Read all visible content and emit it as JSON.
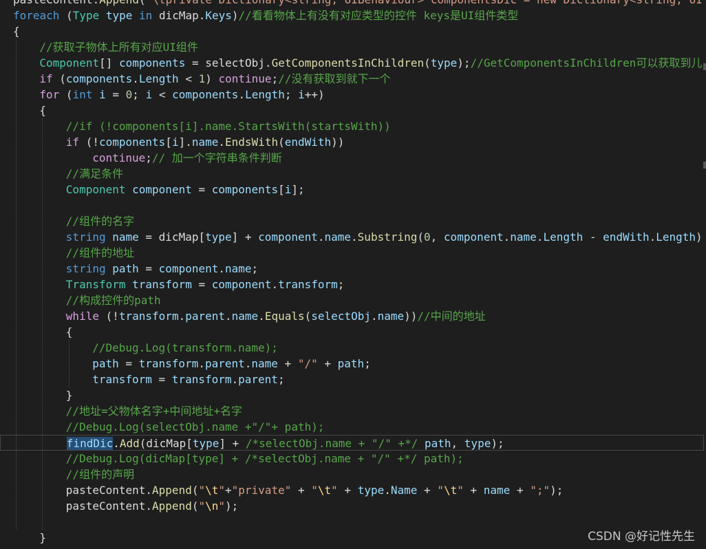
{
  "editor": {
    "lines": [
      [
        [
          "pl",
          "pasteContent."
        ],
        [
          "fn",
          "Append"
        ],
        [
          "pl",
          "("
        ],
        [
          "st",
          "\"\\tprivate Dictionary<string, UIBehaviour> componentsDic = new Dictionary<string, UI"
        ]
      ],
      [
        [
          "kw",
          "foreach"
        ],
        [
          "pl",
          " ("
        ],
        [
          "ty",
          "Type"
        ],
        [
          "pl",
          " "
        ],
        [
          "id",
          "type"
        ],
        [
          "pl",
          " "
        ],
        [
          "kw",
          "in"
        ],
        [
          "pl",
          " dicMap."
        ],
        [
          "id",
          "Keys"
        ],
        [
          "pl",
          ")"
        ],
        [
          "cm",
          "//看看物体上有没有对应类型的控件 keys是UI组件类型"
        ]
      ],
      [
        [
          "pl",
          "{"
        ]
      ],
      [
        [
          "cm",
          "//获取子物体上所有对应UI组件"
        ]
      ],
      [
        [
          "ty",
          "Component"
        ],
        [
          "pl",
          "[] "
        ],
        [
          "id",
          "components"
        ],
        [
          "pl",
          " = selectObj."
        ],
        [
          "fn",
          "GetComponentsInChildren"
        ],
        [
          "pl",
          "("
        ],
        [
          "id",
          "type"
        ],
        [
          "pl",
          ");"
        ],
        [
          "cm",
          "//GetComponentsInChildren可以获取到儿"
        ]
      ],
      [
        [
          "ctl",
          "if"
        ],
        [
          "pl",
          " ("
        ],
        [
          "id",
          "components"
        ],
        [
          "pl",
          "."
        ],
        [
          "id",
          "Length"
        ],
        [
          "pl",
          " < "
        ],
        [
          "nu",
          "1"
        ],
        [
          "pl",
          ") "
        ],
        [
          "ctl",
          "continue"
        ],
        [
          "pl",
          ";"
        ],
        [
          "cm",
          "//没有获取到就下一个"
        ]
      ],
      [
        [
          "ctl",
          "for"
        ],
        [
          "pl",
          " ("
        ],
        [
          "kw",
          "int"
        ],
        [
          "pl",
          " "
        ],
        [
          "id",
          "i"
        ],
        [
          "pl",
          " = "
        ],
        [
          "nu",
          "0"
        ],
        [
          "pl",
          "; "
        ],
        [
          "id",
          "i"
        ],
        [
          "pl",
          " < "
        ],
        [
          "id",
          "components"
        ],
        [
          "pl",
          "."
        ],
        [
          "id",
          "Length"
        ],
        [
          "pl",
          "; "
        ],
        [
          "id",
          "i"
        ],
        [
          "pl",
          "++)"
        ]
      ],
      [
        [
          "pl",
          "{"
        ]
      ],
      [
        [
          "cm",
          "//if (!components[i].name.StartsWith(startsWith))"
        ]
      ],
      [
        [
          "ctl",
          "if"
        ],
        [
          "pl",
          " (!"
        ],
        [
          "id",
          "components"
        ],
        [
          "pl",
          "["
        ],
        [
          "id",
          "i"
        ],
        [
          "pl",
          "]."
        ],
        [
          "id",
          "name"
        ],
        [
          "pl",
          "."
        ],
        [
          "fn",
          "EndsWith"
        ],
        [
          "pl",
          "("
        ],
        [
          "id",
          "endWith"
        ],
        [
          "pl",
          "))"
        ]
      ],
      [
        [
          "ctl",
          "continue"
        ],
        [
          "pl",
          ";"
        ],
        [
          "cm",
          "// 加一个字符串条件判断"
        ]
      ],
      [
        [
          "cm",
          "//满足条件"
        ]
      ],
      [
        [
          "ty",
          "Component"
        ],
        [
          "pl",
          " "
        ],
        [
          "id",
          "component"
        ],
        [
          "pl",
          " = "
        ],
        [
          "id",
          "components"
        ],
        [
          "pl",
          "["
        ],
        [
          "id",
          "i"
        ],
        [
          "pl",
          "];"
        ]
      ],
      [],
      [
        [
          "cm",
          "//组件的名字"
        ]
      ],
      [
        [
          "kw",
          "string"
        ],
        [
          "pl",
          " "
        ],
        [
          "id",
          "name"
        ],
        [
          "pl",
          " = dicMap["
        ],
        [
          "id",
          "type"
        ],
        [
          "pl",
          "] + "
        ],
        [
          "id",
          "component"
        ],
        [
          "pl",
          "."
        ],
        [
          "id",
          "name"
        ],
        [
          "pl",
          "."
        ],
        [
          "fn",
          "Substring"
        ],
        [
          "pl",
          "("
        ],
        [
          "nu",
          "0"
        ],
        [
          "pl",
          ", "
        ],
        [
          "id",
          "component"
        ],
        [
          "pl",
          "."
        ],
        [
          "id",
          "name"
        ],
        [
          "pl",
          "."
        ],
        [
          "id",
          "Length"
        ],
        [
          "pl",
          " - "
        ],
        [
          "id",
          "endWith"
        ],
        [
          "pl",
          "."
        ],
        [
          "id",
          "Length"
        ],
        [
          "pl",
          ")"
        ]
      ],
      [
        [
          "cm",
          "//组件的地址"
        ]
      ],
      [
        [
          "kw",
          "string"
        ],
        [
          "pl",
          " "
        ],
        [
          "id",
          "path"
        ],
        [
          "pl",
          " = "
        ],
        [
          "id",
          "component"
        ],
        [
          "pl",
          "."
        ],
        [
          "id",
          "name"
        ],
        [
          "pl",
          ";"
        ]
      ],
      [
        [
          "ty",
          "Transform"
        ],
        [
          "pl",
          " "
        ],
        [
          "id",
          "transform"
        ],
        [
          "pl",
          " = "
        ],
        [
          "id",
          "component"
        ],
        [
          "pl",
          "."
        ],
        [
          "id",
          "transform"
        ],
        [
          "pl",
          ";"
        ]
      ],
      [
        [
          "cm",
          "//构成控件的path"
        ]
      ],
      [
        [
          "ctl",
          "while"
        ],
        [
          "pl",
          " (!"
        ],
        [
          "id",
          "transform"
        ],
        [
          "pl",
          "."
        ],
        [
          "id",
          "parent"
        ],
        [
          "pl",
          "."
        ],
        [
          "id",
          "name"
        ],
        [
          "pl",
          "."
        ],
        [
          "fn",
          "Equals"
        ],
        [
          "pl",
          "("
        ],
        [
          "id",
          "selectObj"
        ],
        [
          "pl",
          "."
        ],
        [
          "id",
          "name"
        ],
        [
          "pl",
          "))"
        ],
        [
          "cm",
          "//中间的地址"
        ]
      ],
      [
        [
          "pl",
          "{"
        ]
      ],
      [
        [
          "cm",
          "//Debug.Log(transform.name);"
        ]
      ],
      [
        [
          "id",
          "path"
        ],
        [
          "pl",
          " = "
        ],
        [
          "id",
          "transform"
        ],
        [
          "pl",
          "."
        ],
        [
          "id",
          "parent"
        ],
        [
          "pl",
          "."
        ],
        [
          "id",
          "name"
        ],
        [
          "pl",
          " + "
        ],
        [
          "st",
          "\"/\""
        ],
        [
          "pl",
          " + "
        ],
        [
          "id",
          "path"
        ],
        [
          "pl",
          ";"
        ]
      ],
      [
        [
          "id",
          "transform"
        ],
        [
          "pl",
          " = "
        ],
        [
          "id",
          "transform"
        ],
        [
          "pl",
          "."
        ],
        [
          "id",
          "parent"
        ],
        [
          "pl",
          ";"
        ]
      ],
      [
        [
          "pl",
          "}"
        ]
      ],
      [
        [
          "cm",
          "//地址=父物体名字+中间地址+名字"
        ]
      ],
      [
        [
          "cm",
          "//Debug.Log(selectObj.name +\"/\"+ path);"
        ]
      ],
      [
        [
          "id sel",
          "findDic"
        ],
        [
          "pl",
          "."
        ],
        [
          "fn",
          "Add"
        ],
        [
          "pl",
          "(dicMap["
        ],
        [
          "id",
          "type"
        ],
        [
          "pl",
          "] + "
        ],
        [
          "cm",
          "/*selectObj.name + \"/\" +*/"
        ],
        [
          "pl",
          " "
        ],
        [
          "id",
          "path"
        ],
        [
          "pl",
          ", "
        ],
        [
          "id",
          "type"
        ],
        [
          "pl",
          ");"
        ]
      ],
      [
        [
          "cm",
          "//Debug.Log(dicMap[type] + /*selectObj.name + \"/\" +*/ path);"
        ]
      ],
      [
        [
          "cm",
          "//组件的声明"
        ]
      ],
      [
        [
          "pl",
          "pasteContent."
        ],
        [
          "fn",
          "Append"
        ],
        [
          "pl",
          "("
        ],
        [
          "st",
          "\""
        ],
        [
          "es",
          "\\t"
        ],
        [
          "st",
          "\""
        ],
        [
          "pl",
          "+"
        ],
        [
          "st",
          "\"private\""
        ],
        [
          "pl",
          " + "
        ],
        [
          "st",
          "\""
        ],
        [
          "es",
          "\\t"
        ],
        [
          "st",
          "\""
        ],
        [
          "pl",
          " + "
        ],
        [
          "id",
          "type"
        ],
        [
          "pl",
          "."
        ],
        [
          "id",
          "Name"
        ],
        [
          "pl",
          " + "
        ],
        [
          "st",
          "\""
        ],
        [
          "es",
          "\\t"
        ],
        [
          "st",
          "\""
        ],
        [
          "pl",
          " + "
        ],
        [
          "id",
          "name"
        ],
        [
          "pl",
          " + "
        ],
        [
          "st",
          "\";\""
        ],
        [
          "pl",
          ");"
        ]
      ],
      [
        [
          "pl",
          "pasteContent."
        ],
        [
          "fn",
          "Append"
        ],
        [
          "pl",
          "("
        ],
        [
          "st",
          "\""
        ],
        [
          "es",
          "\\n"
        ],
        [
          "st",
          "\""
        ],
        [
          "pl",
          ");"
        ]
      ],
      [],
      [
        [
          "pl",
          "}"
        ]
      ]
    ]
  },
  "watermark": "CSDN @好记性先生"
}
